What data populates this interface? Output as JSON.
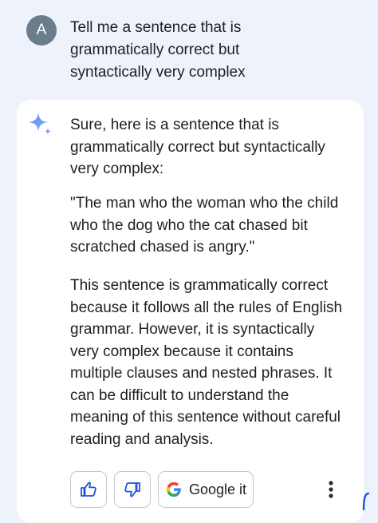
{
  "user": {
    "avatar_letter": "A",
    "prompt": "Tell me a sentence that is grammatically correct but syntactically very complex"
  },
  "response": {
    "intro": "Sure, here is a sentence that is grammatically correct but syntactically very complex:",
    "quote": "\"The man who the woman who the child who the dog who the cat chased bit scratched chased is angry.\"",
    "explanation": "This sentence is grammatically correct because it follows all the rules of English grammar. However, it is syntactically very complex because it contains multiple clauses and nested phrases. It can be difficult to understand the meaning of this sentence without careful reading and analysis."
  },
  "actions": {
    "google_it_label": "Google it",
    "icons": [
      "thumbs-up-icon",
      "thumbs-down-icon",
      "google-g-icon",
      "more-vertical-icon"
    ]
  },
  "colors": {
    "page_background": "#eef2fa",
    "card_background": "#ffffff",
    "avatar_background": "#6b7c8c",
    "accent_blue": "#1a56db",
    "sparkle_blue": "#5b8def"
  }
}
